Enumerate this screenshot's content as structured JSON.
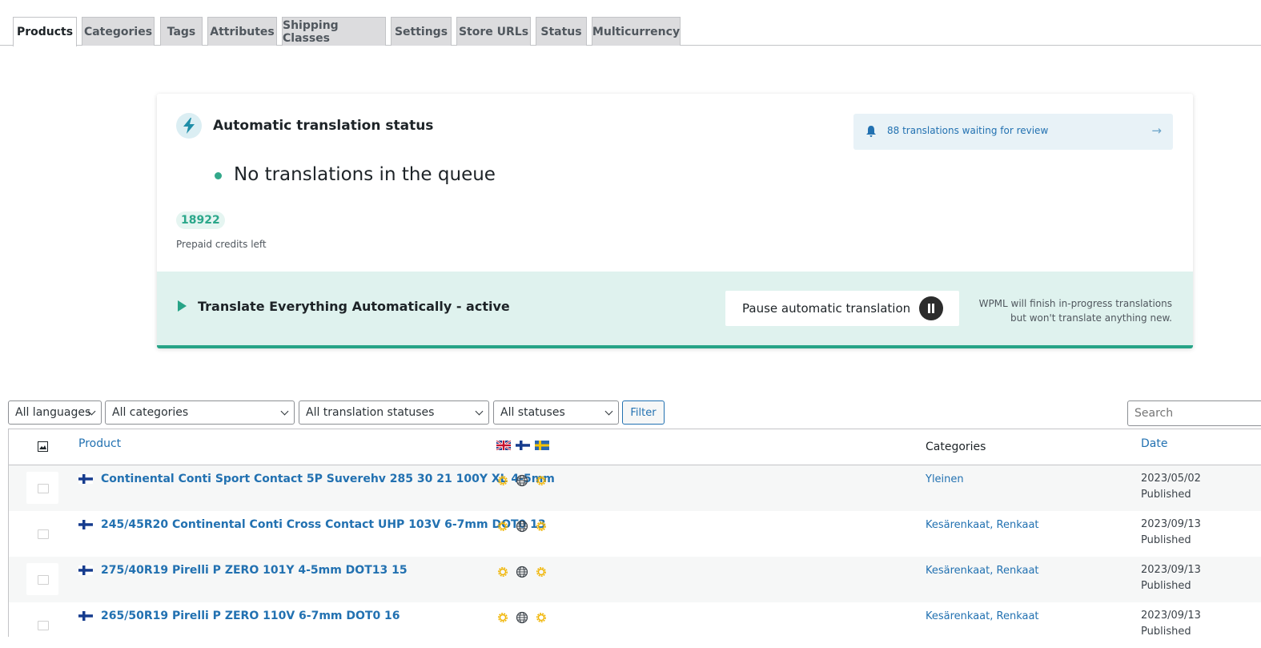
{
  "tabs": [
    {
      "label": "Products",
      "active": true
    },
    {
      "label": "Categories"
    },
    {
      "label": "Tags"
    },
    {
      "label": "Attributes"
    },
    {
      "label": "Shipping Classes"
    },
    {
      "label": "Settings"
    },
    {
      "label": "Store URLs"
    },
    {
      "label": "Status"
    },
    {
      "label": "Multicurrency"
    }
  ],
  "status_card": {
    "title": "Automatic translation status",
    "queue_text": "No translations in the queue",
    "credits": "18922",
    "credits_label": "Prepaid credits left",
    "review_link": "88 translations waiting for review",
    "review_arrow": "→",
    "active_label": "Translate Everything Automatically - active",
    "pause_label": "Pause automatic translation",
    "note": "WPML will finish in-progress translations but won't translate anything new."
  },
  "filters": {
    "languages": "All languages",
    "categories": "All categories",
    "translation_statuses": "All translation statuses",
    "statuses": "All statuses",
    "filter_button": "Filter",
    "search_placeholder": "Search"
  },
  "table": {
    "columns": {
      "product": "Product",
      "categories": "Categories",
      "date": "Date"
    },
    "rows": [
      {
        "name": "Continental Conti Sport Contact 5P Suverehv 285 30 21 100Y XL 4-5mm",
        "categories": "Yleinen",
        "date": "2023/05/02",
        "status": "Published"
      },
      {
        "name": "245/45R20 Continental Conti Cross Contact UHP 103V 6-7mm DOT0 13",
        "categories": "Kesärenkaat, Renkaat",
        "date": "2023/09/13",
        "status": "Published"
      },
      {
        "name": "275/40R19 Pirelli P ZERO 101Y 4-5mm DOT13 15",
        "categories": "Kesärenkaat, Renkaat",
        "date": "2023/09/13",
        "status": "Published"
      },
      {
        "name": "265/50R19 Pirelli P ZERO 110V 6-7mm DOT0 16",
        "categories": "Kesärenkaat, Renkaat",
        "date": "2023/09/13",
        "status": "Published"
      }
    ]
  },
  "colors": {
    "accent": "#2271b1",
    "success": "#27a487",
    "gear": "#f0b400"
  }
}
